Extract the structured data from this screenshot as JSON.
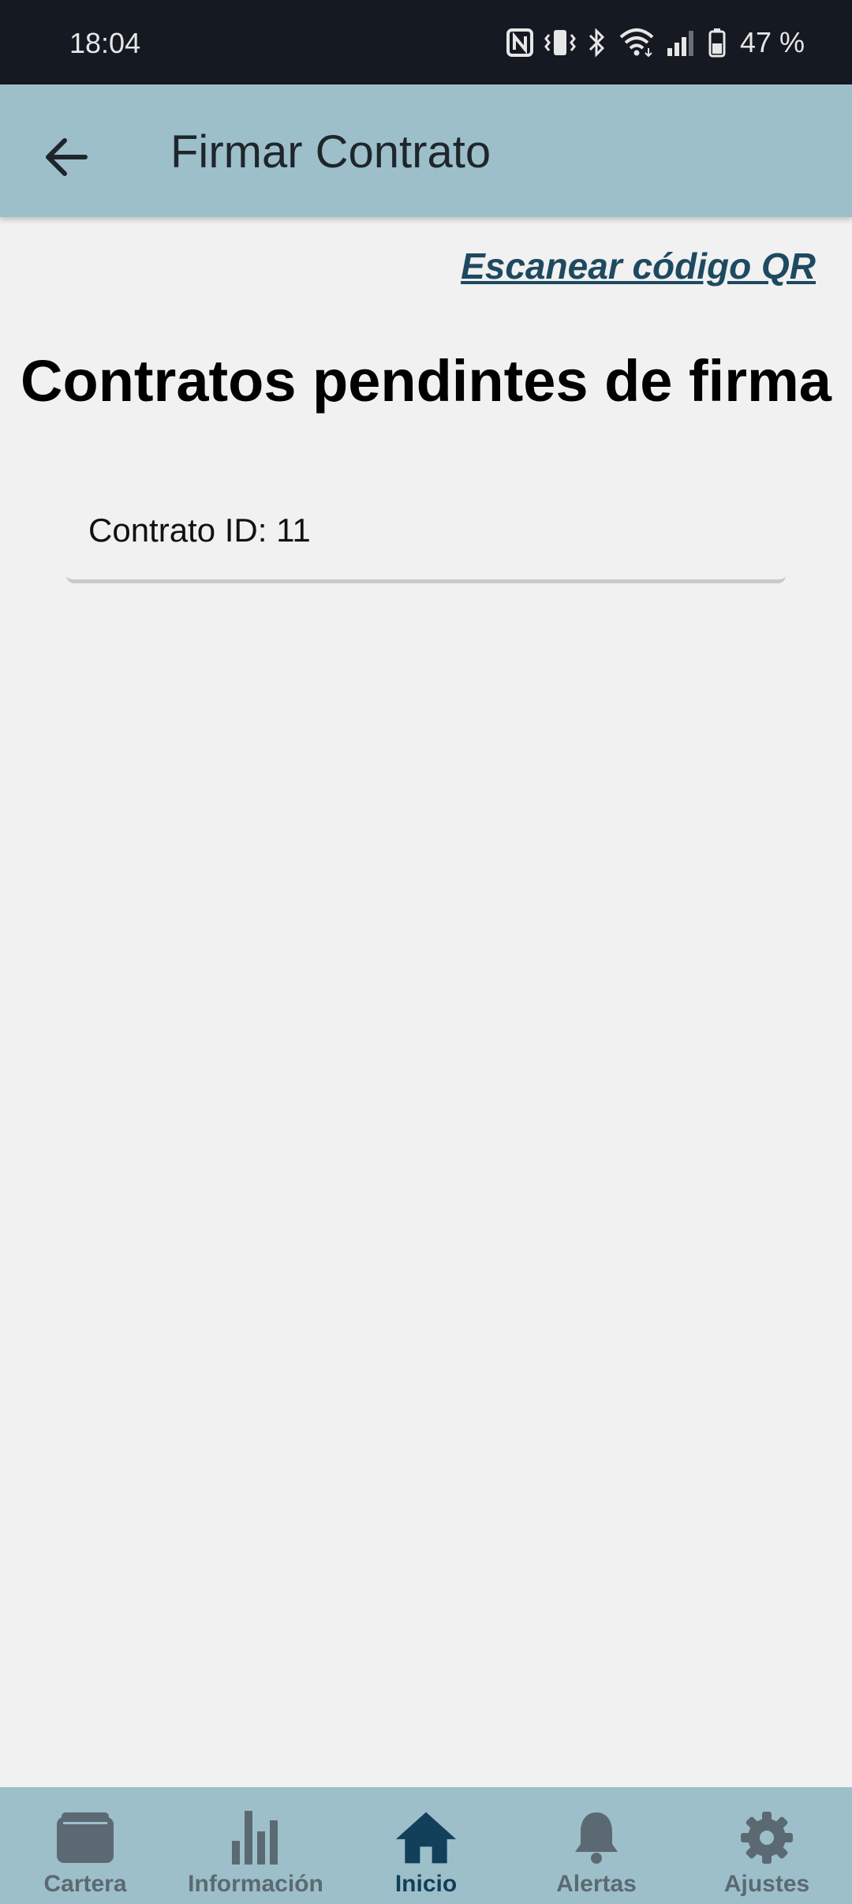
{
  "status_bar": {
    "time": "18:04",
    "battery": "47 %",
    "icons": [
      "nfc-icon",
      "vibrate-icon",
      "bluetooth-icon",
      "wifi-icon",
      "signal-icon",
      "battery-icon"
    ]
  },
  "app_bar": {
    "title": "Firmar Contrato",
    "back_icon": "arrow-left-icon"
  },
  "main": {
    "scan_link": "Escanear código QR",
    "section_title": "Contratos pendintes de firma",
    "contracts": [
      {
        "label": "Contrato ID: 11"
      }
    ]
  },
  "bottom_nav": {
    "items": [
      {
        "label": "Cartera",
        "icon": "wallet-icon"
      },
      {
        "label": "Información",
        "icon": "bar-chart-icon"
      },
      {
        "label": "Inicio",
        "icon": "home-icon",
        "active": true
      },
      {
        "label": "Alertas",
        "icon": "bell-icon"
      },
      {
        "label": "Ajustes",
        "icon": "gear-icon"
      }
    ]
  },
  "colors": {
    "app_bar": "#9dbfca",
    "status_bar": "#141922",
    "accent": "#123f5a",
    "inactive": "#5b6a72",
    "background": "#f1f1f1"
  }
}
